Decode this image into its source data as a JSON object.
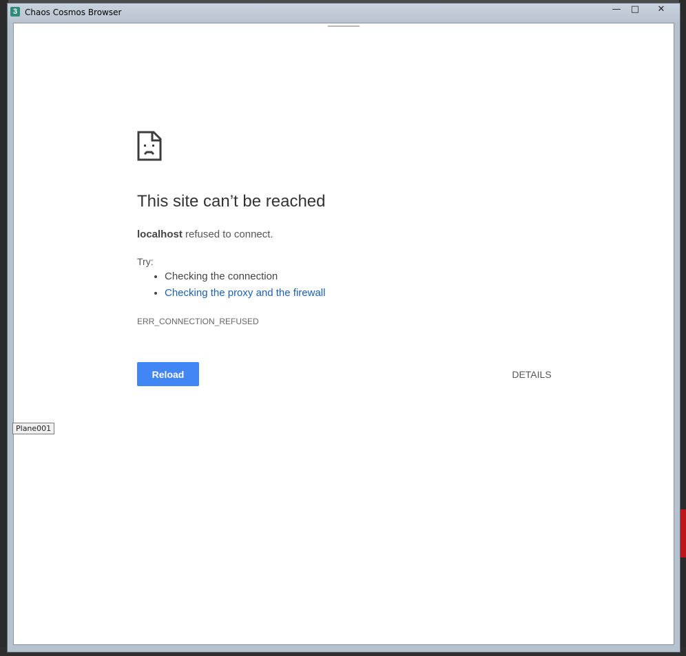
{
  "window": {
    "title": "Chaos Cosmos Browser",
    "icon_text": "3",
    "minimize_glyph": "—",
    "maximize_glyph": "□",
    "close_glyph": "✕"
  },
  "error_page": {
    "icon": "sad-page-icon",
    "heading": "This site can’t be reached",
    "host": "localhost",
    "refused_text": " refused to connect.",
    "try_label": "Try:",
    "suggestions": [
      {
        "text": "Checking the connection",
        "is_link": false
      },
      {
        "text": "Checking the proxy and the firewall",
        "is_link": true
      }
    ],
    "error_code": "ERR_CONNECTION_REFUSED",
    "reload_label": "Reload",
    "details_label": "DETAILS"
  },
  "viewport_label": "Plane001",
  "colors": {
    "primary_button": "#4285f4",
    "link": "#1a5fb4",
    "heading_text": "#333333"
  }
}
